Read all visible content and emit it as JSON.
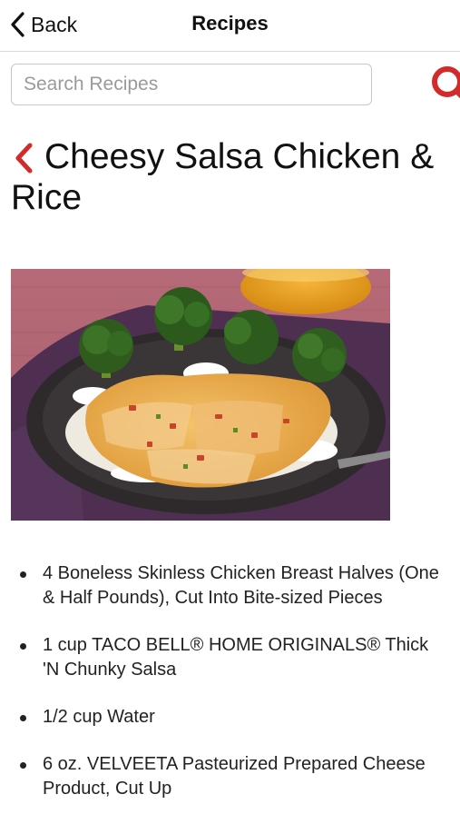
{
  "nav": {
    "back_label": "Back",
    "title": "Recipes"
  },
  "search": {
    "placeholder": "Search Recipes",
    "button_icon": "search-icon"
  },
  "recipe": {
    "title": "Cheesy Salsa Chicken & Rice",
    "title_icon": "chevron-left-icon",
    "accent_color": "#d22b2b",
    "ingredients": [
      "4 Boneless Skinless Chicken Breast Halves (One & Half Pounds), Cut Into Bite-sized Pieces",
      "1 cup TACO BELL® HOME ORIGINALS® Thick 'N Chunky Salsa",
      "1/2 cup Water",
      "6 oz. VELVEETA Pasteurized Prepared Cheese Product, Cut Up"
    ]
  }
}
